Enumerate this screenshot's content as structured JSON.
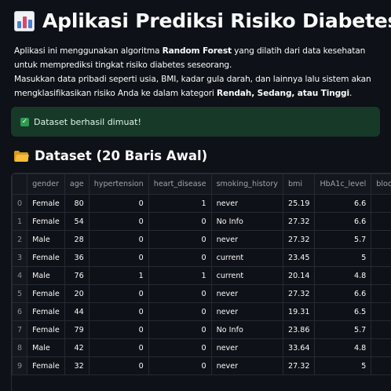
{
  "header": {
    "title": "Aplikasi Prediksi Risiko Diabetes"
  },
  "description": {
    "p1_before": "Aplikasi ini menggunakan algoritma ",
    "p1_bold": "Random Forest",
    "p1_after": " yang dilatih dari data kesehatan untuk memprediksi tingkat risiko diabetes seseorang.",
    "p2_before": "Masukkan data pribadi seperti usia, BMI, kadar gula darah, dan lainnya lalu sistem akan mengklasifikasikan risiko Anda ke dalam kategori ",
    "p2_bold": "Rendah, Sedang, atau Tinggi",
    "p2_after": "."
  },
  "alert": {
    "text": "Dataset berhasil dimuat!"
  },
  "section": {
    "title": "Dataset (20 Baris Awal)"
  },
  "table": {
    "columns": [
      "",
      "gender",
      "age",
      "hypertension",
      "heart_disease",
      "smoking_history",
      "bmi",
      "HbA1c_level",
      "blood_glucose_"
    ],
    "rows": [
      [
        "0",
        "Female",
        "80",
        "0",
        "1",
        "never",
        "25.19",
        "6.6",
        ""
      ],
      [
        "1",
        "Female",
        "54",
        "0",
        "0",
        "No Info",
        "27.32",
        "6.6",
        ""
      ],
      [
        "2",
        "Male",
        "28",
        "0",
        "0",
        "never",
        "27.32",
        "5.7",
        ""
      ],
      [
        "3",
        "Female",
        "36",
        "0",
        "0",
        "current",
        "23.45",
        "5",
        ""
      ],
      [
        "4",
        "Male",
        "76",
        "1",
        "1",
        "current",
        "20.14",
        "4.8",
        ""
      ],
      [
        "5",
        "Female",
        "20",
        "0",
        "0",
        "never",
        "27.32",
        "6.6",
        ""
      ],
      [
        "6",
        "Female",
        "44",
        "0",
        "0",
        "never",
        "19.31",
        "6.5",
        ""
      ],
      [
        "7",
        "Female",
        "79",
        "0",
        "0",
        "No Info",
        "23.86",
        "5.7",
        ""
      ],
      [
        "8",
        "Male",
        "42",
        "0",
        "0",
        "never",
        "33.64",
        "4.8",
        ""
      ],
      [
        "9",
        "Female",
        "32",
        "0",
        "0",
        "never",
        "27.32",
        "5",
        ""
      ]
    ]
  }
}
